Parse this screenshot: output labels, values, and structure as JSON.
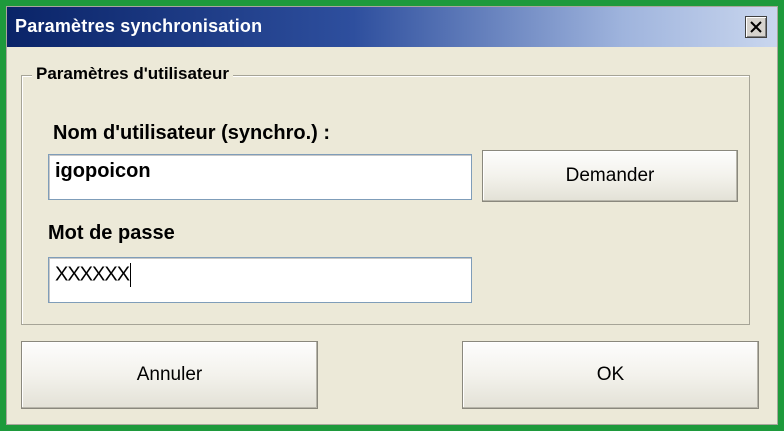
{
  "window": {
    "title": "Paramètres synchronisation",
    "close_icon": "close-icon"
  },
  "group": {
    "legend": "Paramètres d'utilisateur",
    "username_label": "Nom d'utilisateur (synchro.) :",
    "username_value": "igopoicon",
    "password_label": "Mot de passe",
    "password_value": "XXXXXX"
  },
  "buttons": {
    "request": "Demander",
    "cancel": "Annuler",
    "ok": "OK"
  },
  "colors": {
    "desktop": "#1e9a3c",
    "title_bar_start": "#0a2468",
    "title_bar_end": "#c9d6ee",
    "dialog_bg": "#ece9d8"
  }
}
